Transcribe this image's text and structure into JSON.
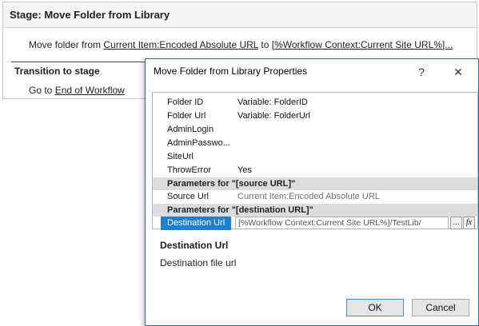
{
  "stage": {
    "title": "Stage: Move Folder from Library",
    "action_prefix": "Move folder from ",
    "source_link": "Current Item:Encoded Absolute URL",
    "to_text": " to ",
    "dest_link": "[%Workflow Context:Current Site URL%]...",
    "transition_title": "Transition to stage",
    "goto_prefix": "Go to ",
    "goto_link": "End of Workflow"
  },
  "dialog": {
    "title": "Move Folder from Library Properties",
    "help_label": "?",
    "close_label": "✕",
    "properties": [
      {
        "name": "Folder ID",
        "value": "Variable: FolderID"
      },
      {
        "name": "Folder Url",
        "value": "Variable: FolderUrl"
      },
      {
        "name": "AdminLogin",
        "value": ""
      },
      {
        "name": "AdminPasswo...",
        "value": ""
      },
      {
        "name": "SiteUrl",
        "value": ""
      },
      {
        "name": "ThrowError",
        "value": "Yes"
      }
    ],
    "section_source": "Parameters for \"[source URL]\"",
    "source_url": {
      "name": "Source Url",
      "value": "Current Item:Encoded Absolute URL"
    },
    "section_dest": "Parameters for \"[destination URL]\"",
    "dest_url": {
      "name": "Destination Url",
      "value": "[%Workflow Context:Current Site URL%]/TestLib/"
    },
    "ellipsis_label": "...",
    "fx_label": "fx",
    "description_title": "Destination Url",
    "description_text": "Destination file url",
    "ok_label": "OK",
    "cancel_label": "Cancel"
  },
  "colors": {
    "selection": "#1e7fd6",
    "dialog_border": "#1e70c8",
    "section_bg": "#dcdcdc"
  }
}
